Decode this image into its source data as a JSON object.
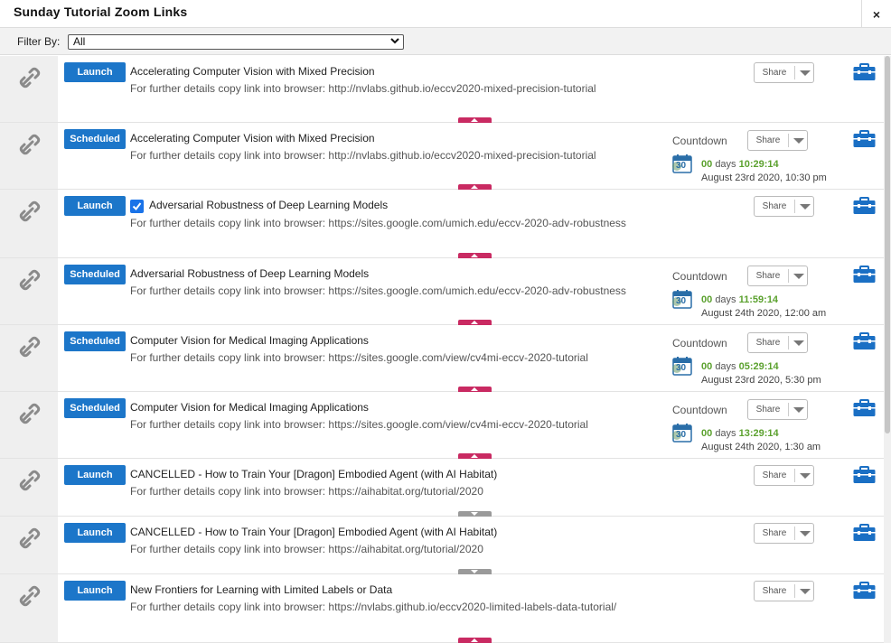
{
  "window": {
    "title": "Sunday Tutorial Zoom Links",
    "close_label": "×"
  },
  "filter": {
    "label": "Filter By:",
    "selected": "All"
  },
  "rows": [
    {
      "button": "Launch",
      "title": "Accelerating Computer Vision with Mixed Precision",
      "details": "For further details copy link into browser: http://nvlabs.github.io/eccv2020-mixed-precision-tutorial",
      "share": "Share",
      "checked": false,
      "expander": "pink"
    },
    {
      "button": "Scheduled",
      "title": "Accelerating Computer Vision with Mixed Precision",
      "details": "For further details copy link into browser: http://nvlabs.github.io/eccv2020-mixed-precision-tutorial",
      "share": "Share",
      "countdown_label": "Countdown",
      "cal_day": "30",
      "countdown_days": "00",
      "days_word": "days",
      "countdown_time": "10:29:14",
      "countdown_date": "August 23rd 2020, 10:30 pm",
      "expander": "pink"
    },
    {
      "button": "Launch",
      "title": "Adversarial Robustness of Deep Learning Models",
      "details": "For further details copy link into browser: https://sites.google.com/umich.edu/eccv-2020-adv-robustness",
      "share": "Share",
      "checked": true,
      "expander": "pink"
    },
    {
      "button": "Scheduled",
      "title": "Adversarial Robustness of Deep Learning Models",
      "details": "For further details copy link into browser: https://sites.google.com/umich.edu/eccv-2020-adv-robustness",
      "share": "Share",
      "countdown_label": "Countdown",
      "cal_day": "30",
      "countdown_days": "00",
      "days_word": "days",
      "countdown_time": "11:59:14",
      "countdown_date": "August 24th 2020, 12:00 am",
      "expander": "pink"
    },
    {
      "button": "Scheduled",
      "title": "Computer Vision for Medical Imaging Applications",
      "details": "For further details copy link into browser: https://sites.google.com/view/cv4mi-eccv-2020-tutorial",
      "share": "Share",
      "countdown_label": "Countdown",
      "cal_day": "30",
      "countdown_days": "00",
      "days_word": "days",
      "countdown_time": "05:29:14",
      "countdown_date": "August 23rd 2020, 5:30 pm",
      "expander": "pink"
    },
    {
      "button": "Scheduled",
      "title": "Computer Vision for Medical Imaging Applications",
      "details": "For further details copy link into browser: https://sites.google.com/view/cv4mi-eccv-2020-tutorial",
      "share": "Share",
      "countdown_label": "Countdown",
      "cal_day": "30",
      "countdown_days": "00",
      "days_word": "days",
      "countdown_time": "13:29:14",
      "countdown_date": "August 24th 2020, 1:30 am",
      "expander": "pink"
    },
    {
      "button": "Launch",
      "title": "CANCELLED - How to Train Your [Dragon] Embodied Agent (with AI Habitat)",
      "details": "For further details copy link into browser: https://aihabitat.org/tutorial/2020",
      "share": "Share",
      "checked": false,
      "expander": "gray"
    },
    {
      "button": "Launch",
      "title": "CANCELLED - How to Train Your [Dragon] Embodied Agent (with AI Habitat)",
      "details": "For further details copy link into browser: https://aihabitat.org/tutorial/2020",
      "share": "Share",
      "checked": false,
      "expander": "gray"
    },
    {
      "button": "Launch",
      "title": "New Frontiers for Learning with Limited Labels or Data",
      "details": "For further details copy link into browser: https://nvlabs.github.io/eccv2020-limited-labels-data-tutorial/",
      "share": "Share",
      "checked": false,
      "expander": "pink"
    }
  ],
  "colors": {
    "button_blue": "#1c76c9",
    "countdown_green": "#5ba12e",
    "expander_pink": "#c92a62",
    "toolbox_blue": "#1a6fc4"
  },
  "icons": {
    "row_link": "link-icon",
    "toolbox": "toolbox-icon",
    "calendar": "calendar-icon",
    "share_dropdown": "chevron-down-icon"
  }
}
